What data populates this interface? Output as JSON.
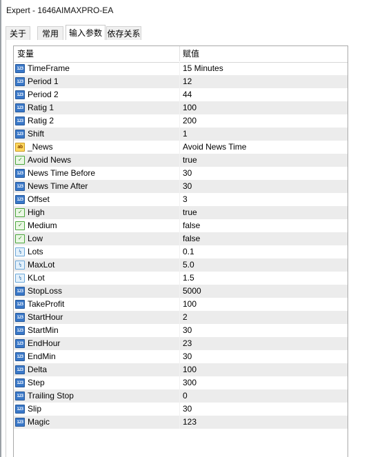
{
  "window": {
    "title": "Expert - 1646AIMAXPRO-EA"
  },
  "tabs": [
    {
      "label": "关于"
    },
    {
      "label": "常用"
    },
    {
      "label": "输入参数"
    },
    {
      "label": "依存关系"
    }
  ],
  "active_tab": "输入参数",
  "table": {
    "columns": {
      "variable": "变量",
      "value": "赋值"
    },
    "rows": [
      {
        "name": "TimeFrame",
        "value": "15 Minutes",
        "type_icon": "int-icon"
      },
      {
        "name": "Period 1",
        "value": "12",
        "type_icon": "int-icon"
      },
      {
        "name": "Period 2",
        "value": "44",
        "type_icon": "int-icon"
      },
      {
        "name": "Ratig 1",
        "value": "100",
        "type_icon": "int-icon"
      },
      {
        "name": "Ratig 2",
        "value": "200",
        "type_icon": "int-icon"
      },
      {
        "name": "Shift",
        "value": "1",
        "type_icon": "int-icon"
      },
      {
        "name": "_News",
        "value": "Avoid News Time",
        "type_icon": "string-icon"
      },
      {
        "name": "Avoid News",
        "value": "true",
        "type_icon": "bool-icon"
      },
      {
        "name": "News Time Before",
        "value": "30",
        "type_icon": "int-icon"
      },
      {
        "name": "News Time After",
        "value": "30",
        "type_icon": "int-icon"
      },
      {
        "name": "Offset",
        "value": "3",
        "type_icon": "int-icon"
      },
      {
        "name": "High",
        "value": "true",
        "type_icon": "bool-icon"
      },
      {
        "name": "Medium",
        "value": "false",
        "type_icon": "bool-icon"
      },
      {
        "name": "Low",
        "value": "false",
        "type_icon": "bool-icon"
      },
      {
        "name": "Lots",
        "value": "0.1",
        "type_icon": "double-icon"
      },
      {
        "name": "MaxLot",
        "value": "5.0",
        "type_icon": "double-icon"
      },
      {
        "name": "KLot",
        "value": "1.5",
        "type_icon": "double-icon"
      },
      {
        "name": "StopLoss",
        "value": "5000",
        "type_icon": "int-icon"
      },
      {
        "name": "TakeProfit",
        "value": "100",
        "type_icon": "int-icon"
      },
      {
        "name": "StartHour",
        "value": "2",
        "type_icon": "int-icon"
      },
      {
        "name": "StartMin",
        "value": "30",
        "type_icon": "int-icon"
      },
      {
        "name": "EndHour",
        "value": "23",
        "type_icon": "int-icon"
      },
      {
        "name": "EndMin",
        "value": "30",
        "type_icon": "int-icon"
      },
      {
        "name": "Delta",
        "value": "100",
        "type_icon": "int-icon"
      },
      {
        "name": "Step",
        "value": "300",
        "type_icon": "int-icon"
      },
      {
        "name": "Trailing Stop",
        "value": "0",
        "type_icon": "int-icon"
      },
      {
        "name": "Slip",
        "value": "30",
        "type_icon": "int-icon"
      },
      {
        "name": "Magic",
        "value": "123",
        "type_icon": "int-icon"
      }
    ]
  }
}
